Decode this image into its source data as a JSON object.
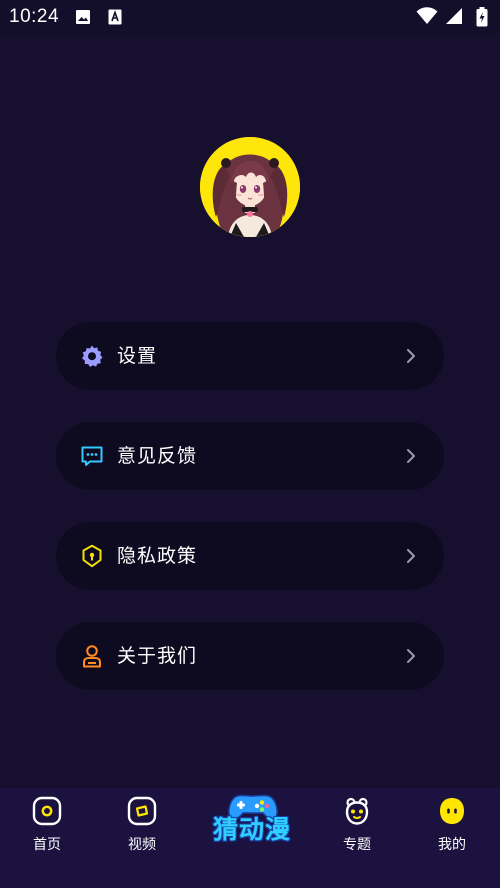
{
  "status_bar": {
    "time": "10:24",
    "left_icons": [
      "image-icon",
      "text-a-icon"
    ],
    "right_icons": [
      "wifi-icon",
      "signal-icon",
      "battery-icon"
    ]
  },
  "profile": {
    "avatar_icon": "avatar-anime-girl"
  },
  "menu": {
    "items": [
      {
        "label": "设置",
        "icon": "gear-icon",
        "color": "#9a9cff"
      },
      {
        "label": "意见反馈",
        "icon": "chat-bubble-icon",
        "color": "#35c8ff"
      },
      {
        "label": "隐私政策",
        "icon": "shield-icon",
        "color": "#f5e100"
      },
      {
        "label": "关于我们",
        "icon": "person-icon",
        "color": "#ff8a1f"
      }
    ]
  },
  "tabbar": {
    "tabs": [
      {
        "label": "首页",
        "icon": "home-icon"
      },
      {
        "label": "视频",
        "icon": "video-icon"
      },
      {
        "label": "专题",
        "icon": "topic-icon"
      },
      {
        "label": "我的",
        "icon": "mine-icon",
        "active_color": "#ffe600"
      }
    ],
    "center": {
      "label": "猜动漫",
      "icon": "gamepad-icon"
    }
  },
  "colors": {
    "background": "#16102e",
    "card": "#0e0a20",
    "tabbar": "#1b1240",
    "accent_yellow": "#ffe600"
  }
}
